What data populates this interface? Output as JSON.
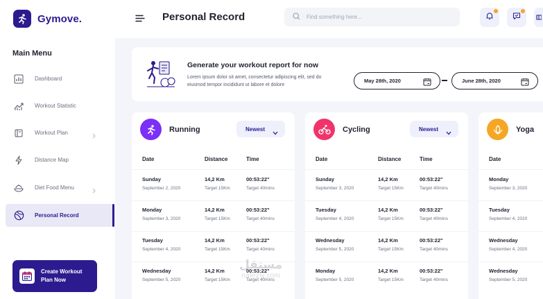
{
  "brand": {
    "name": "Gymove."
  },
  "sidebar": {
    "menu_title": "Main Menu",
    "items": [
      {
        "label": "Dashboard",
        "icon": "bar-chart-icon",
        "has_submenu": false,
        "active": false
      },
      {
        "label": "Workout Statistic",
        "icon": "trend-line-icon",
        "has_submenu": false,
        "active": false
      },
      {
        "label": "Workout Plan",
        "icon": "notebook-icon",
        "has_submenu": true,
        "active": false
      },
      {
        "label": "Distance Map",
        "icon": "lightning-icon",
        "has_submenu": false,
        "active": false
      },
      {
        "label": "Diet Food Menu",
        "icon": "food-bowl-icon",
        "has_submenu": true,
        "active": false
      },
      {
        "label": "Personal Record",
        "icon": "ball-icon",
        "has_submenu": false,
        "active": true
      }
    ],
    "cta_label": "Create Workout Plan Now"
  },
  "header": {
    "title": "Personal Record",
    "search_placeholder": "Find something here..."
  },
  "report": {
    "title": "Generate your workout report for now",
    "description": "Lorem ipsum dolor sit amet, consectetur adipiscing elit, sed do eiusmod tempor incididunt ut labore et dolore",
    "date_from": "May 28th, 2020",
    "date_to": "June 28th, 2020"
  },
  "columns": {
    "date": "Date",
    "distance": "Distance",
    "time": "Time"
  },
  "activities": [
    {
      "name": "Running",
      "sort": "Newest",
      "color": "#7b2ff7",
      "rows": [
        {
          "day": "Sunday",
          "date": "September 2, 2020",
          "distance": "14,2 Km",
          "target_distance": "Target 15Km",
          "time": "00:53:22\"",
          "target_time": "Target 40mins"
        },
        {
          "day": "Monday",
          "date": "September 3, 2020",
          "distance": "14,2 Km",
          "target_distance": "Target 15Km",
          "time": "00:53:22\"",
          "target_time": "Target 40mins"
        },
        {
          "day": "Tuesday",
          "date": "September 4, 2020",
          "distance": "14,2 Km",
          "target_distance": "Target 15Km",
          "time": "00:53:22\"",
          "target_time": "Target 40mins"
        },
        {
          "day": "Wednesday",
          "date": "September 5, 2020",
          "distance": "14,2 Km",
          "target_distance": "Target 15Km",
          "time": "00:53:22\"",
          "target_time": "Target 40mins"
        }
      ]
    },
    {
      "name": "Cycling",
      "sort": "Newest",
      "color": "#f0346b",
      "rows": [
        {
          "day": "Sunday",
          "date": "September 3, 2020",
          "distance": "14,2 Km",
          "target_distance": "Target 15Km",
          "time": "00:53:22\"",
          "target_time": "Target 40mins"
        },
        {
          "day": "Tuesday",
          "date": "September 4, 2020",
          "distance": "14,2 Km",
          "target_distance": "Target 15Km",
          "time": "00:53:22\"",
          "target_time": "Target 40mins"
        },
        {
          "day": "Wednesday",
          "date": "September 5, 2020",
          "distance": "14,2 Km",
          "target_distance": "Target 15Km",
          "time": "00:53:22\"",
          "target_time": "Target 40mins"
        },
        {
          "day": "Monday",
          "date": "September 5, 2020",
          "distance": "14,2 Km",
          "target_distance": "Target 15Km",
          "time": "00:53:22\"",
          "target_time": "Target 40mins"
        }
      ]
    },
    {
      "name": "Yoga",
      "sort": "",
      "color": "#f5a623",
      "rows": [
        {
          "day": "Monday",
          "date": "September 3, 2020"
        },
        {
          "day": "Tuesday",
          "date": "September 4, 2020"
        },
        {
          "day": "Wednesday",
          "date": "September 4, 2020"
        },
        {
          "day": "Wednesday",
          "date": "September 5, 2020"
        }
      ]
    }
  ],
  "watermark": {
    "script": "مستقل",
    "site": "nafezly.com"
  }
}
